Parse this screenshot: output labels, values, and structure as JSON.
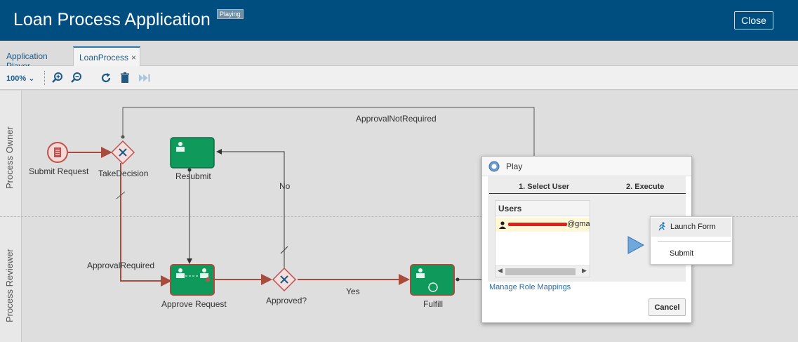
{
  "app": {
    "title": "Loan Process Application",
    "status_badge": "Playing",
    "close_label": "Close"
  },
  "tabs": [
    {
      "label": "Application Player"
    },
    {
      "label": "LoanProcess",
      "close": "×"
    }
  ],
  "toolbar": {
    "zoom": "100%",
    "icons": [
      "zoom-in-icon",
      "zoom-out-icon",
      "refresh-icon",
      "trash-icon",
      "fast-forward-icon"
    ]
  },
  "lanes": [
    "Process Owner",
    "Process Reviewer"
  ],
  "diagram": {
    "nodes": {
      "submit_request": "Submit Request",
      "take_decision": "TakeDecision",
      "resubmit": "Resubmit",
      "approve_request": "Approve Request",
      "approved": "Approved?",
      "fulfill": "Fulfill"
    },
    "flows": {
      "approval_not_required": "ApprovalNotRequired",
      "approval_required": "ApprovalRequired",
      "no": "No",
      "yes": "Yes"
    }
  },
  "dialog": {
    "title": "Play",
    "step1": "1. Select User",
    "step2": "2. Execute",
    "users_header": "Users",
    "user_visible_text": "@gmai",
    "menu": {
      "launch_form": "Launch Form",
      "submit": "Submit"
    },
    "manage_link": "Manage Role Mappings",
    "cancel": "Cancel"
  },
  "colors": {
    "header": "#004d80",
    "task_green": "#0f9a5c",
    "flow_red": "#a84c3d",
    "gateway": "#c0504d",
    "accent_blue": "#2a78b3"
  }
}
